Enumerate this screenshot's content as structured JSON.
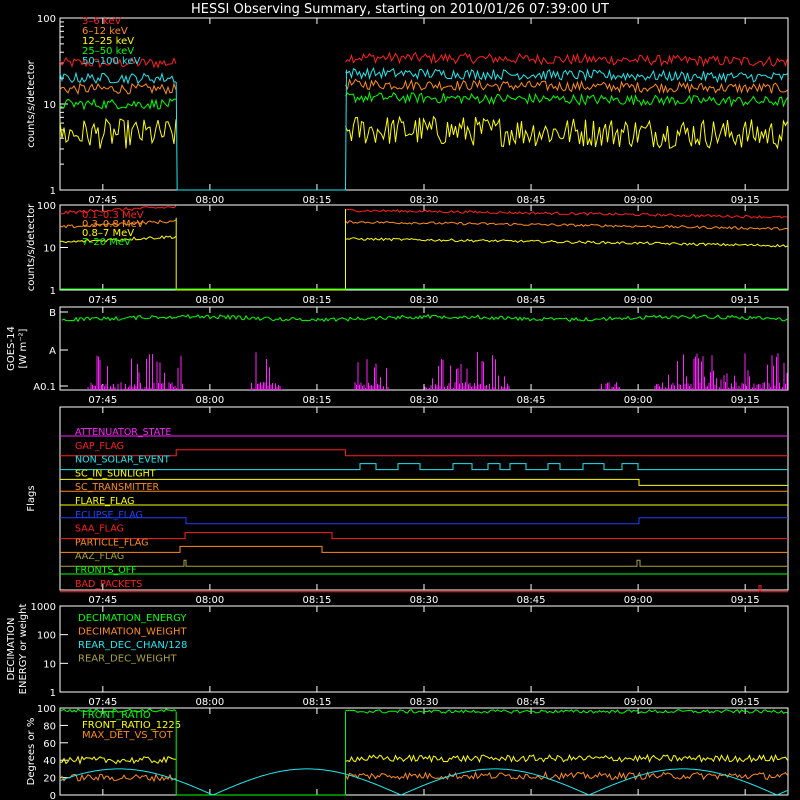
{
  "title": "HESSI Observing Summary, starting on 2010/01/26 07:39:00 UT",
  "time_ticks": [
    "07:45",
    "08:00",
    "08:15",
    "08:30",
    "08:45",
    "09:00",
    "09:15"
  ],
  "colors": {
    "red": "#ff2020",
    "orange": "#ff8c1a",
    "yellow": "#ffff00",
    "green": "#00ff00",
    "cyan": "#20e8f0",
    "magenta": "#ff20ff",
    "blue": "#2040ff",
    "olive": "#a8a040"
  },
  "chart_data": [
    {
      "type": "line",
      "ylabel": "counts/s/detector",
      "ylog": true,
      "ytick_labels": [
        "1",
        "10",
        "100"
      ],
      "series": [
        {
          "name": "3–6 keV",
          "color": "red",
          "level_before": 30,
          "level_after": 35
        },
        {
          "name": "6–12 keV",
          "color": "orange",
          "level_before": 15,
          "level_after": 17
        },
        {
          "name": "12–25 keV",
          "color": "yellow",
          "level_before": 4.5,
          "level_after": 5
        },
        {
          "name": "25–50 keV",
          "color": "green",
          "level_before": 10,
          "level_after": 12
        },
        {
          "name": "50–100 keV",
          "color": "cyan",
          "level_before": 20,
          "level_after": 23
        }
      ],
      "gap": [
        "07:55",
        "08:19"
      ]
    },
    {
      "type": "line",
      "ylabel": "counts/s/detector",
      "ylog": true,
      "ytick_labels": [
        "1",
        "10",
        "100"
      ],
      "series": [
        {
          "name": "0.1–0.3 MeV",
          "color": "red",
          "level_before": 65,
          "level_after": 75
        },
        {
          "name": "0.3–0.8 MeV",
          "color": "orange",
          "level_before": 30,
          "level_after": 40
        },
        {
          "name": "0.8–7 MeV",
          "color": "yellow",
          "level_before": 13,
          "level_after": 16
        },
        {
          "name": "7–20 MeV",
          "color": "green",
          "level_before": 1,
          "level_after": 1
        }
      ],
      "gap": [
        "07:55",
        "08:19"
      ]
    },
    {
      "type": "line",
      "ylabel": "GOES-14",
      "ylabel2": "[W m⁻²]",
      "ytick_labels": [
        "A0.1",
        "A",
        "B"
      ]
    },
    {
      "type": "line",
      "ylabel": "Flags",
      "flags": [
        {
          "name": "ATTENUATOR_STATE",
          "color": "magenta"
        },
        {
          "name": "GAP_FLAG",
          "color": "red"
        },
        {
          "name": "NON_SOLAR_EVENT",
          "color": "cyan"
        },
        {
          "name": "SC_IN_SUNLIGHT",
          "color": "yellow"
        },
        {
          "name": "SC_TRANSMITTER",
          "color": "orange"
        },
        {
          "name": "FLARE_FLAG",
          "color": "yellow"
        },
        {
          "name": "ECLIPSE_FLAG",
          "color": "blue"
        },
        {
          "name": "SAA_FLAG",
          "color": "red"
        },
        {
          "name": "PARTICLE_FLAG",
          "color": "orange"
        },
        {
          "name": "AAZ_FLAG",
          "color": "olive"
        },
        {
          "name": "FRONTS_OFF",
          "color": "green"
        },
        {
          "name": "BAD_PACKETS",
          "color": "red"
        }
      ]
    },
    {
      "type": "line",
      "ylabel": "DECIMATION",
      "ylabel2": "ENERGY or weight",
      "ytick_labels": [
        "1",
        "10",
        "100",
        "1000"
      ],
      "series": [
        {
          "name": "DECIMATION_ENERGY",
          "color": "green"
        },
        {
          "name": "DECIMATION_WEIGHT",
          "color": "orange"
        },
        {
          "name": "REAR_DEC_CHAN/128",
          "color": "cyan"
        },
        {
          "name": "REAR_DEC_WEIGHT",
          "color": "olive"
        }
      ]
    },
    {
      "type": "line",
      "ylabel": "Degrees or %",
      "ytick_labels": [
        "0",
        "20",
        "40",
        "60",
        "80",
        "100"
      ],
      "series": [
        {
          "name": "FRONT_RATIO",
          "color": "green",
          "level_before": 97,
          "level_after": 96
        },
        {
          "name": "FRONT_RATIO_1225",
          "color": "yellow",
          "level_before": 40,
          "level_after": 42
        },
        {
          "name": "MAX_DET_VS_TOT",
          "color": "orange",
          "level_before": 20,
          "level_after": 22
        }
      ]
    }
  ]
}
